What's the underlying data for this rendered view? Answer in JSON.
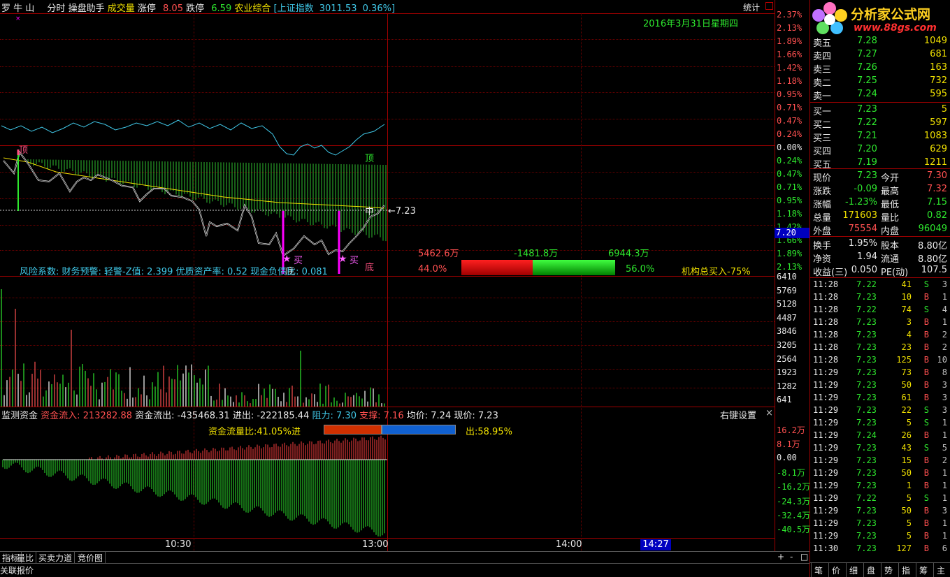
{
  "header": {
    "stock_name": "罗 牛 山",
    "mode": "分时",
    "assistant": "操盘助手",
    "volume_label": "成交量",
    "limit_up_label": "涨停",
    "limit_up": "8.05",
    "limit_down_label": "跌停",
    "limit_down": "6.59",
    "sector": "农业综合",
    "index_label": "[上证指数",
    "index_value": "3011.53",
    "index_change": "0.36%]",
    "stats_label": "统计",
    "date": "2016年3月31日星期四"
  },
  "logo": {
    "name": "分析家公式网",
    "url": "www.88gs.com"
  },
  "price_axis_right": [
    "2.37%",
    "2.13%",
    "1.89%",
    "1.66%",
    "1.42%",
    "1.18%",
    "0.95%",
    "0.71%",
    "0.47%",
    "0.24%",
    "0.00%",
    "0.24%",
    "0.47%",
    "0.71%",
    "0.95%",
    "1.18%",
    "1.42%",
    "1.66%",
    "1.89%",
    "2.13%"
  ],
  "price_marker": "7.20",
  "current_arrow": "←7.23",
  "chart_labels": {
    "top1": "顶",
    "top2": "顶",
    "bottom1": "底",
    "bottom2": "底",
    "buy1": "买",
    "buy2": "买",
    "mid": "中"
  },
  "risk_bar": {
    "text": "风险系数: 财务预警: 轻警-Z值: 2.399 优质资产率: 0.52 现金负债比: 0.081",
    "left_value": "5462.6万",
    "mid_value": "-1481.8万",
    "right_value": "6944.3万",
    "left_pct": "44.0%",
    "right_pct": "56.0%",
    "institution": "机构总买入-75%"
  },
  "volume_axis": [
    "6410",
    "5769",
    "5128",
    "4487",
    "3846",
    "3205",
    "2564",
    "1923",
    "1282",
    "641"
  ],
  "fund_monitor": {
    "title": "监测资金",
    "inflow_label": "资金流入:",
    "inflow": "213282.88",
    "outflow_label": "资金流出:",
    "outflow": "-435468.31",
    "net_label": "进出:",
    "net": "-222185.44",
    "resist_label": "阻力:",
    "resist": "7.30",
    "support_label": "支撑:",
    "support": "7.16",
    "avg_label": "均价:",
    "avg": "7.24",
    "price_label": "现价:",
    "price": "7.23",
    "settings": "右键设置",
    "close": "×",
    "ratio_label": "资金流量比:41.05%进",
    "out_label": "出:58.95%"
  },
  "fund_axis": [
    "16.2万",
    "8.1万",
    "0.00",
    "-8.1万",
    "-16.2万",
    "-24.3万",
    "-32.4万",
    "-40.5万"
  ],
  "time_axis": [
    "10:30",
    "13:00",
    "14:00"
  ],
  "time_marker": "14:27",
  "bottom_tabs": [
    "指标",
    "量比",
    "买卖力道",
    "竞价图"
  ],
  "bottom_status": "关联报价",
  "zoom_buttons": [
    "+",
    "-",
    "□"
  ],
  "right_tabs": [
    "笔",
    "价",
    "细",
    "盘",
    "势",
    "指",
    "筹",
    "主"
  ],
  "orderbook": {
    "asks": [
      {
        "label": "卖五",
        "price": "7.28",
        "vol": "1049"
      },
      {
        "label": "卖四",
        "price": "7.27",
        "vol": "681"
      },
      {
        "label": "卖三",
        "price": "7.26",
        "vol": "163"
      },
      {
        "label": "卖二",
        "price": "7.25",
        "vol": "732"
      },
      {
        "label": "卖一",
        "price": "7.24",
        "vol": "595"
      }
    ],
    "bids": [
      {
        "label": "买一",
        "price": "7.23",
        "vol": "5"
      },
      {
        "label": "买二",
        "price": "7.22",
        "vol": "597"
      },
      {
        "label": "买三",
        "price": "7.21",
        "vol": "1083"
      },
      {
        "label": "买四",
        "price": "7.20",
        "vol": "629"
      },
      {
        "label": "买五",
        "price": "7.19",
        "vol": "1211"
      }
    ]
  },
  "quote": [
    {
      "l1": "现价",
      "v1": "7.23",
      "c1": "green",
      "l2": "今开",
      "v2": "7.30",
      "c2": "red"
    },
    {
      "l1": "涨跌",
      "v1": "-0.09",
      "c1": "green",
      "l2": "最高",
      "v2": "7.32",
      "c2": "red"
    },
    {
      "l1": "涨幅",
      "v1": "-1.23%",
      "c1": "green",
      "l2": "最低",
      "v2": "7.15",
      "c2": "green"
    },
    {
      "l1": "总量",
      "v1": "171603",
      "c1": "yellow",
      "l2": "量比",
      "v2": "0.82",
      "c2": "green"
    },
    {
      "l1": "外盘",
      "v1": "75554",
      "c1": "red",
      "l2": "内盘",
      "v2": "96049",
      "c2": "green"
    }
  ],
  "quote2": [
    {
      "l1": "换手",
      "v1": "1.95%",
      "l2": "股本",
      "v2": "8.80亿"
    },
    {
      "l1": "净资",
      "v1": "1.94",
      "l2": "流通",
      "v2": "8.80亿"
    },
    {
      "l1": "收益(三)",
      "v1": "0.050",
      "l2": "PE(动)",
      "v2": "107.5"
    }
  ],
  "ticks": [
    {
      "t": "11:28",
      "p": "7.22",
      "v": "41",
      "d": "S",
      "n": "3"
    },
    {
      "t": "11:28",
      "p": "7.23",
      "v": "10",
      "d": "B",
      "n": "1"
    },
    {
      "t": "11:28",
      "p": "7.22",
      "v": "74",
      "d": "S",
      "n": "4"
    },
    {
      "t": "11:28",
      "p": "7.23",
      "v": "3",
      "d": "B",
      "n": "1"
    },
    {
      "t": "11:28",
      "p": "7.23",
      "v": "4",
      "d": "B",
      "n": "2"
    },
    {
      "t": "11:28",
      "p": "7.23",
      "v": "23",
      "d": "B",
      "n": "2"
    },
    {
      "t": "11:28",
      "p": "7.23",
      "v": "125",
      "d": "B",
      "n": "10"
    },
    {
      "t": "11:29",
      "p": "7.23",
      "v": "73",
      "d": "B",
      "n": "8"
    },
    {
      "t": "11:29",
      "p": "7.23",
      "v": "50",
      "d": "B",
      "n": "3"
    },
    {
      "t": "11:29",
      "p": "7.23",
      "v": "61",
      "d": "B",
      "n": "3"
    },
    {
      "t": "11:29",
      "p": "7.23",
      "v": "22",
      "d": "S",
      "n": "3"
    },
    {
      "t": "11:29",
      "p": "7.23",
      "v": "5",
      "d": "S",
      "n": "1"
    },
    {
      "t": "11:29",
      "p": "7.24",
      "v": "26",
      "d": "B",
      "n": "1"
    },
    {
      "t": "11:29",
      "p": "7.23",
      "v": "43",
      "d": "S",
      "n": "5"
    },
    {
      "t": "11:29",
      "p": "7.23",
      "v": "15",
      "d": "B",
      "n": "2"
    },
    {
      "t": "11:29",
      "p": "7.23",
      "v": "50",
      "d": "B",
      "n": "1"
    },
    {
      "t": "11:29",
      "p": "7.23",
      "v": "1",
      "d": "B",
      "n": "1"
    },
    {
      "t": "11:29",
      "p": "7.22",
      "v": "5",
      "d": "S",
      "n": "1"
    },
    {
      "t": "11:29",
      "p": "7.23",
      "v": "50",
      "d": "B",
      "n": "3"
    },
    {
      "t": "11:29",
      "p": "7.23",
      "v": "5",
      "d": "B",
      "n": "1"
    },
    {
      "t": "11:29",
      "p": "7.23",
      "v": "5",
      "d": "B",
      "n": "1"
    },
    {
      "t": "11:30",
      "p": "7.23",
      "v": "127",
      "d": "B",
      "n": "6"
    }
  ],
  "colors": {
    "up": "#ff5050",
    "down": "#2ee82e",
    "grid": "#a00000",
    "price_line": "#ffffff",
    "avg_line": "#f0e000",
    "index_line": "#40c8e8",
    "magenta": "#ff00ff"
  }
}
